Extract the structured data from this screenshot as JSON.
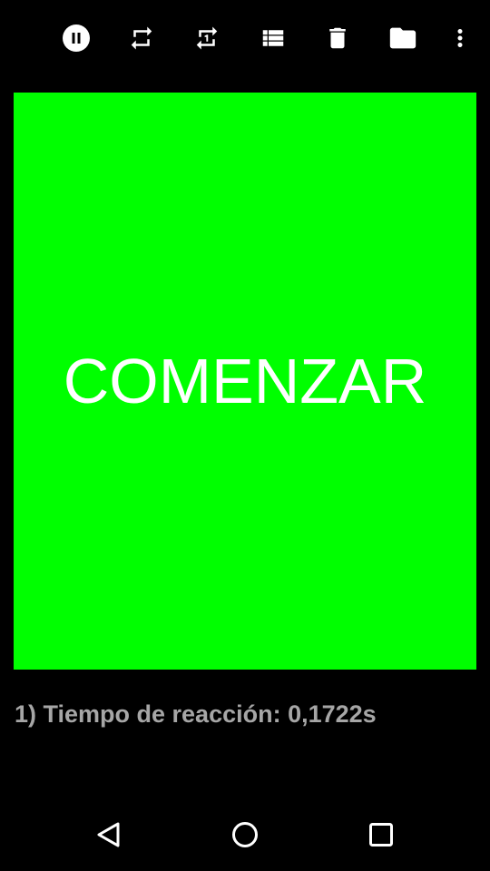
{
  "toolbar": {
    "icons": [
      "pause-icon",
      "repeat-icon",
      "repeat-one-icon",
      "list-icon",
      "delete-icon",
      "folder-icon",
      "more-vert-icon"
    ]
  },
  "start_panel": {
    "label": "COMENZAR",
    "color": "#00ff00"
  },
  "results": [
    {
      "text": "1) Tiempo de reacción: 0,1722s"
    }
  ],
  "theme": {
    "background": "#000000",
    "text_muted": "#a6a6a6",
    "icon": "#ffffff"
  },
  "navbar": {
    "icons": [
      "back-icon",
      "home-icon",
      "recents-icon"
    ]
  }
}
